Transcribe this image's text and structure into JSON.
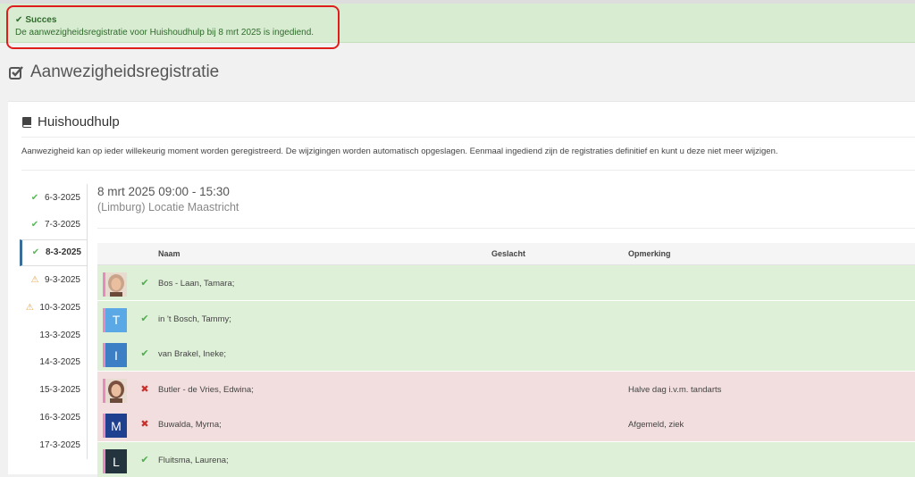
{
  "alert": {
    "title": "Succes",
    "message": "De aanwezigheidsregistratie voor Huishoudhulp bij 8 mrt 2025 is ingediend.",
    "color": "#2f6b2a"
  },
  "page": {
    "title": "Aanwezigheidsregistratie"
  },
  "card": {
    "title": "Huishoudhulp",
    "description": "Aanwezigheid kan op ieder willekeurig moment worden geregistreerd. De wijzigingen worden automatisch opgeslagen. Eenmaal ingediend zijn de registraties definitief en kunt u deze niet meer wijzigen."
  },
  "dates": [
    {
      "label": "6-3-2025",
      "status": "check"
    },
    {
      "label": "7-3-2025",
      "status": "check"
    },
    {
      "label": "8-3-2025",
      "status": "check",
      "active": true
    },
    {
      "label": "9-3-2025",
      "status": "warning"
    },
    {
      "label": "10-3-2025",
      "status": "warning"
    },
    {
      "label": "13-3-2025",
      "status": ""
    },
    {
      "label": "14-3-2025",
      "status": ""
    },
    {
      "label": "15-3-2025",
      "status": ""
    },
    {
      "label": "16-3-2025",
      "status": ""
    },
    {
      "label": "17-3-2025",
      "status": ""
    }
  ],
  "session": {
    "time": "8 mrt 2025 09:00 - 15:30",
    "location": "(Limburg) Locatie Maastricht"
  },
  "table": {
    "headers": {
      "name": "Naam",
      "gender": "Geslacht",
      "remark": "Opmerking"
    },
    "rows": [
      {
        "name": "Bos - Laan, Tamara;",
        "status": "present",
        "avatar": "photo",
        "letter": "",
        "avatar_color": "#c9a48a",
        "remark": ""
      },
      {
        "name": "in 't Bosch, Tammy;",
        "status": "present",
        "avatar": "letter",
        "letter": "T",
        "avatar_color": "#5aa9e6",
        "remark": ""
      },
      {
        "name": "van Brakel, Ineke;",
        "status": "present",
        "avatar": "letter",
        "letter": "I",
        "avatar_color": "#3d7fc4",
        "remark": ""
      },
      {
        "name": "Butler - de Vries, Edwina;",
        "status": "absent",
        "avatar": "photo",
        "letter": "",
        "avatar_color": "#7a5140",
        "remark": "Halve dag i.v.m. tandarts"
      },
      {
        "name": "Buwalda, Myrna;",
        "status": "absent",
        "avatar": "letter",
        "letter": "M",
        "avatar_color": "#1f3f8f",
        "remark": "Afgemeld, ziek"
      },
      {
        "name": "Fluitsma, Laurena;",
        "status": "present",
        "avatar": "letter",
        "letter": "L",
        "avatar_color": "#24343f",
        "remark": ""
      }
    ]
  }
}
